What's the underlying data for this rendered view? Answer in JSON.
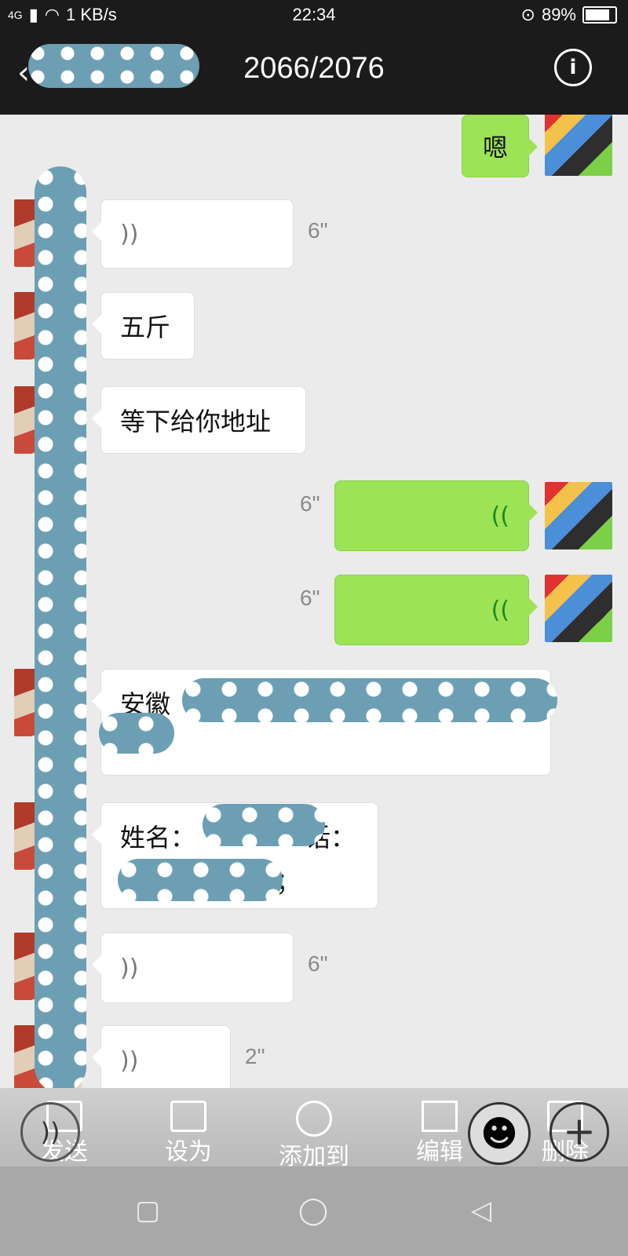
{
  "status": {
    "network": "4G",
    "speed": "1 KB/s",
    "time": "22:34",
    "battery": "89%",
    "battery_fraction": 0.89
  },
  "header": {
    "title": "2066/2076"
  },
  "messages": [
    {
      "side": "right",
      "type": "text",
      "text": "嗯"
    },
    {
      "side": "left",
      "type": "voice",
      "duration": "6\""
    },
    {
      "side": "left",
      "type": "text",
      "text": "五斤"
    },
    {
      "side": "left",
      "type": "text",
      "text": "等下给你地址"
    },
    {
      "side": "right",
      "type": "voice",
      "duration": "6\""
    },
    {
      "side": "right",
      "type": "voice",
      "duration": "6\""
    },
    {
      "side": "left",
      "type": "text",
      "text": "安徽"
    },
    {
      "side": "left",
      "type": "text",
      "line1": "姓名：",
      "line1_end": "话：",
      "line2_end": "7；"
    },
    {
      "side": "left",
      "type": "voice",
      "duration": "6\""
    },
    {
      "side": "left",
      "type": "voice",
      "duration": "2\""
    }
  ],
  "toolbar": {
    "send": "发送",
    "set_as": "设为",
    "add_to": "添加到",
    "edit": "编辑",
    "delete": "删除"
  },
  "icons": {
    "voice_bubble_glyph": "))",
    "voice_self_glyph": "((",
    "emoji_glyph": "☻",
    "plus_glyph": "+",
    "back_glyph": "‹",
    "info_glyph": "i"
  }
}
